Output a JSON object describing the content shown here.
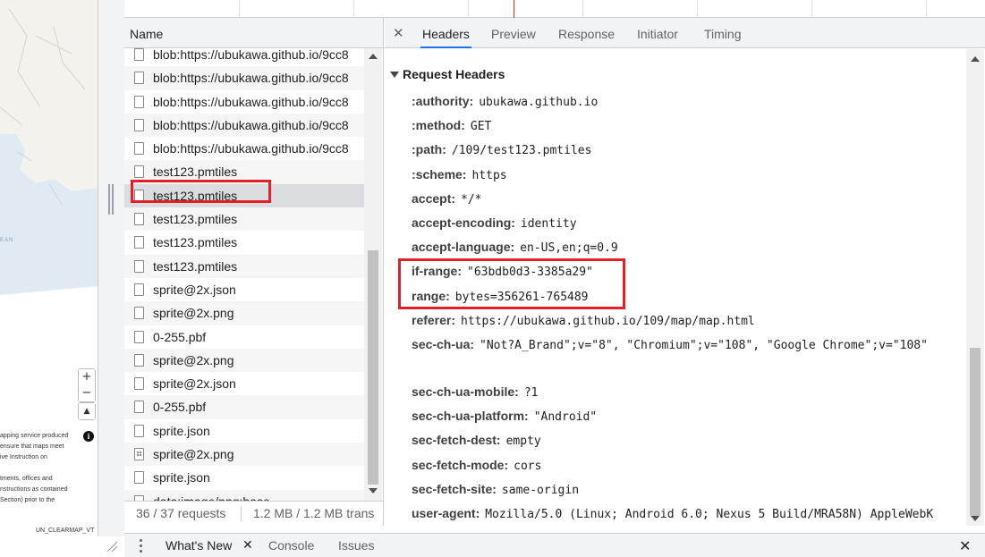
{
  "map": {
    "ocean_label": "EAN",
    "zoom_in": "+",
    "zoom_out": "−",
    "compass": "▲",
    "attribution_lines": [
      "apping service produced",
      "ensure that maps meet",
      "ive Instruction on",
      "",
      "tments, offices and",
      "nstructions as contained",
      "Section) prior to the"
    ],
    "info_icon": "i",
    "footer": "UN_CLEARMAP_VT"
  },
  "request_list": {
    "column_header": "Name",
    "rows": [
      {
        "name": "blob:https://ubukawa.github.io/9cc8",
        "icon": "file-icon",
        "selected": false
      },
      {
        "name": "blob:https://ubukawa.github.io/9cc8",
        "icon": "file-icon",
        "selected": false
      },
      {
        "name": "blob:https://ubukawa.github.io/9cc8",
        "icon": "file-icon",
        "selected": false
      },
      {
        "name": "blob:https://ubukawa.github.io/9cc8",
        "icon": "file-icon",
        "selected": false
      },
      {
        "name": "blob:https://ubukawa.github.io/9cc8",
        "icon": "file-icon",
        "selected": false
      },
      {
        "name": "test123.pmtiles",
        "icon": "file-icon",
        "selected": false
      },
      {
        "name": "test123.pmtiles",
        "icon": "file-icon",
        "selected": true
      },
      {
        "name": "test123.pmtiles",
        "icon": "file-icon",
        "selected": false
      },
      {
        "name": "test123.pmtiles",
        "icon": "file-icon",
        "selected": false
      },
      {
        "name": "test123.pmtiles",
        "icon": "file-icon",
        "selected": false
      },
      {
        "name": "sprite@2x.json",
        "icon": "file-icon",
        "selected": false
      },
      {
        "name": "sprite@2x.png",
        "icon": "file-icon",
        "selected": false
      },
      {
        "name": "0-255.pbf",
        "icon": "file-icon",
        "selected": false
      },
      {
        "name": "sprite@2x.png",
        "icon": "file-icon",
        "selected": false
      },
      {
        "name": "sprite@2x.json",
        "icon": "file-icon",
        "selected": false
      },
      {
        "name": "0-255.pbf",
        "icon": "file-icon",
        "selected": false
      },
      {
        "name": "sprite.json",
        "icon": "file-icon",
        "selected": false
      },
      {
        "name": "sprite@2x.png",
        "icon": "image-file-icon",
        "selected": false
      },
      {
        "name": "sprite.json",
        "icon": "file-icon",
        "selected": false
      },
      {
        "name": "data:image/png;base",
        "icon": "file-icon",
        "selected": false
      }
    ],
    "status": {
      "requests": "36 / 37 requests",
      "transferred": "1.2 MB / 1.2 MB trans"
    }
  },
  "details": {
    "close": "✕",
    "tabs": [
      "Headers",
      "Preview",
      "Response",
      "Initiator",
      "Timing"
    ],
    "active_tab": "Headers",
    "section_title": "Request Headers",
    "headers": [
      {
        "name": ":authority:",
        "value": "ubukawa.github.io"
      },
      {
        "name": ":method:",
        "value": "GET"
      },
      {
        "name": ":path:",
        "value": "/109/test123.pmtiles"
      },
      {
        "name": ":scheme:",
        "value": "https"
      },
      {
        "name": "accept:",
        "value": "*/*"
      },
      {
        "name": "accept-encoding:",
        "value": "identity"
      },
      {
        "name": "accept-language:",
        "value": "en-US,en;q=0.9"
      },
      {
        "name": "if-range:",
        "value": "\"63bdb0d3-3385a29\""
      },
      {
        "name": "range:",
        "value": "bytes=356261-765489"
      },
      {
        "name": "referer:",
        "value": "https://ubukawa.github.io/109/map/map.html"
      },
      {
        "name": "sec-ch-ua:",
        "value": "\"Not?A_Brand\";v=\"8\", \"Chromium\";v=\"108\", \"Google Chrome\";v=\"108\""
      },
      {
        "name": "sec-ch-ua-mobile:",
        "value": "?1"
      },
      {
        "name": "sec-ch-ua-platform:",
        "value": "\"Android\""
      },
      {
        "name": "sec-fetch-dest:",
        "value": "empty"
      },
      {
        "name": "sec-fetch-mode:",
        "value": "cors"
      },
      {
        "name": "sec-fetch-site:",
        "value": "same-origin"
      },
      {
        "name": "user-agent:",
        "value": "Mozilla/5.0 (Linux; Android 6.0; Nexus 5 Build/MRA58N) AppleWebK"
      }
    ]
  },
  "drawer": {
    "tabs": [
      "What's New",
      "Console",
      "Issues"
    ],
    "active_tab": "What's New",
    "tab_close": "✕",
    "drawer_close": "✕"
  },
  "colors": {
    "highlight_box": "#e0202a",
    "active_tab_underline": "#1a73e8"
  }
}
